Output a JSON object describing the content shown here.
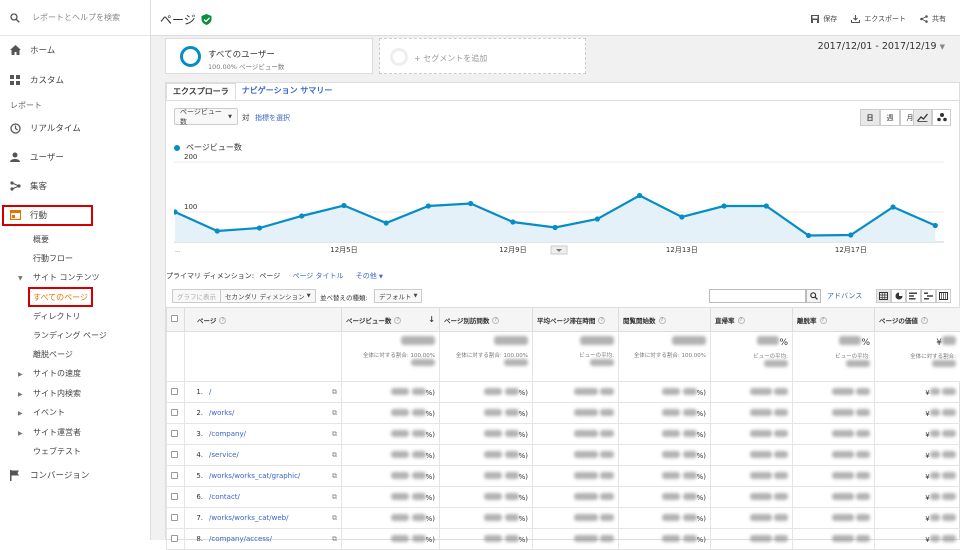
{
  "sidebar": {
    "search_placeholder": "レポートとヘルプを検索",
    "home": "ホーム",
    "custom": "カスタム",
    "reports_label": "レポート",
    "realtime": "リアルタイム",
    "users": "ユーザー",
    "acquisition": "集客",
    "behavior": "行動",
    "overview": "概要",
    "flow": "行動フロー",
    "site_content": "サイト コンテンツ",
    "all_pages": "すべてのページ",
    "directory": "ディレクトリ",
    "landing": "ランディング ページ",
    "exit": "離脱ページ",
    "site_speed": "サイトの速度",
    "site_search": "サイト内検索",
    "events": "イベント",
    "publisher": "サイト運営者",
    "experiments": "ウェブテスト",
    "conversions": "コンバージョン"
  },
  "header": {
    "title": "ページ",
    "save": "保存",
    "export": "エクスポート",
    "share": "共有"
  },
  "segments": {
    "seg1_title": "すべてのユーザー",
    "seg1_sub": "100.00% ページビュー数",
    "seg2_title": "+ セグメントを追加"
  },
  "date_range": "2017/12/01 - 2017/12/19",
  "tabs": {
    "explorer": "エクスプローラ",
    "nav_summary": "ナビゲーション サマリー"
  },
  "metric_select": "ページビュー数",
  "vs": "対",
  "select_metric": "指標を選択",
  "period_buttons": {
    "day": "日",
    "week": "週",
    "month": "月"
  },
  "chart_data": {
    "type": "line",
    "series": [
      {
        "name": "ページビュー数",
        "color": "#058dc7",
        "values": [
          100,
          62,
          68,
          92,
          113,
          78,
          112,
          117,
          80,
          69,
          86,
          133,
          90,
          112,
          112,
          53,
          54,
          110,
          73
        ]
      }
    ],
    "x_tick_labels": [
      {
        "index": 4,
        "label": "12月5日"
      },
      {
        "index": 8,
        "label": "12月9日"
      },
      {
        "index": 12,
        "label": "12月13日"
      },
      {
        "index": 16,
        "label": "12月17日"
      }
    ],
    "x_start_label": "...",
    "y_ticks": [
      100,
      200
    ],
    "ylim": [
      40,
      200
    ]
  },
  "dimension": {
    "label": "プライマリ ディメンション:",
    "page": "ページ",
    "page_title": "ページ タイトル",
    "other": "その他"
  },
  "table_controls": {
    "plot_rows": "グラフに表示",
    "secondary": "セカンダリ ディメンション",
    "sort_label": "並べ替えの種類:",
    "sort_value": "デフォルト",
    "advanced": "アドバンス"
  },
  "table": {
    "headers": [
      "ページ",
      "ページビュー数",
      "ページ別訪問数",
      "平均ページ滞在時間",
      "閲覧開始数",
      "直帰率",
      "離脱率",
      "ページの価値"
    ],
    "totals": {
      "pv_label": "全体に対する割合: 100.00%",
      "visits_label": "全体に対する割合: 100.00%",
      "time_label": "ビューの平均:",
      "entrances_label": "全体に対する割合: 100.00%",
      "bounce_label": "ビューの平均:",
      "exit_label": "ビューの平均:",
      "value_label": "全体に対する割合:",
      "bounce_suffix": "%",
      "exit_suffix": "%",
      "value_prefix": "¥"
    },
    "rows": [
      {
        "n": "1.",
        "url": "/"
      },
      {
        "n": "2.",
        "url": "/works/"
      },
      {
        "n": "3.",
        "url": "/company/"
      },
      {
        "n": "4.",
        "url": "/service/"
      },
      {
        "n": "5.",
        "url": "/works/works_cat/graphic/"
      },
      {
        "n": "6.",
        "url": "/contact/"
      },
      {
        "n": "7.",
        "url": "/works/works_cat/web/"
      },
      {
        "n": "8.",
        "url": "/company/access/"
      }
    ],
    "pct_suffix": "%)",
    "yen": "¥"
  }
}
